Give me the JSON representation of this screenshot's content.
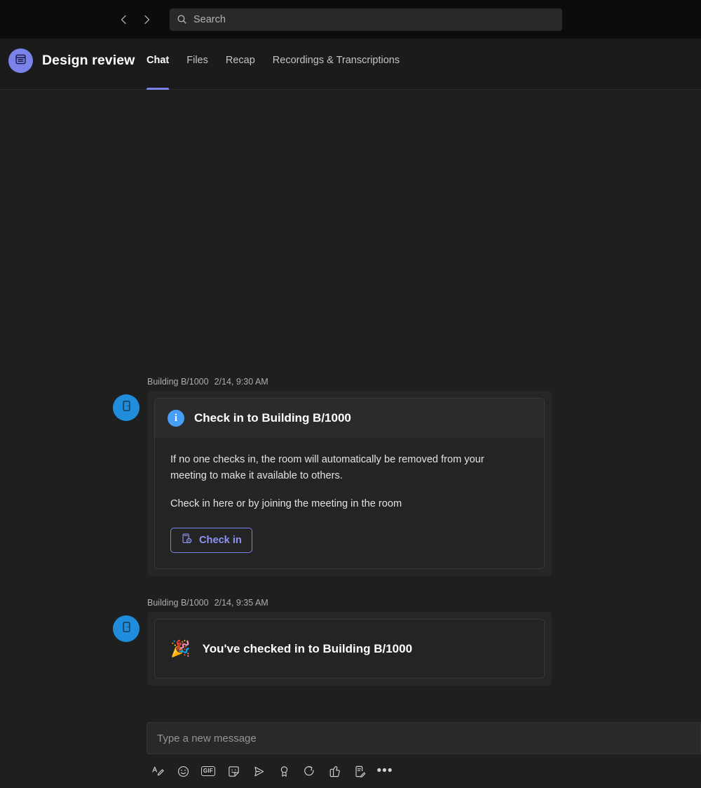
{
  "titlebar": {
    "back_icon": "chevron-left-icon",
    "forward_icon": "chevron-right-icon",
    "search": {
      "icon": "search-icon",
      "value": "",
      "placeholder": "Search"
    }
  },
  "header": {
    "avatar_icon": "meeting-calendar-icon",
    "title": "Design review",
    "tabs": [
      {
        "label": "Chat",
        "active": true
      },
      {
        "label": "Files",
        "active": false
      },
      {
        "label": "Recap",
        "active": false
      },
      {
        "label": "Recordings & Transcriptions",
        "active": false
      }
    ]
  },
  "messages": [
    {
      "sender": "Building B/1000",
      "timestamp": "2/14, 9:30 AM",
      "avatar_icon": "room-door-icon",
      "card": {
        "header_icon": "info-icon",
        "header_title": "Check in to Building B/1000",
        "paragraphs": [
          "If no one checks in, the room will automatically be removed from your meeting to make it available to others.",
          "Check in here or by joining the meeting in the room"
        ],
        "button": {
          "label": "Check in",
          "icon": "room-checkin-icon"
        }
      }
    },
    {
      "sender": "Building B/1000",
      "timestamp": "2/14, 9:35 AM",
      "avatar_icon": "room-door-icon",
      "confirmation": {
        "emoji": "🎉",
        "text": "You've checked in to Building B/1000"
      }
    }
  ],
  "compose": {
    "value": "",
    "placeholder": "Type a new message",
    "tools": [
      {
        "name": "format-text-icon",
        "label": "Format"
      },
      {
        "name": "emoji-icon",
        "label": "Emoji"
      },
      {
        "name": "gif-icon",
        "label": "GIF"
      },
      {
        "name": "sticker-icon",
        "label": "Sticker"
      },
      {
        "name": "send-plane-icon",
        "label": "Send"
      },
      {
        "name": "praise-ribbon-icon",
        "label": "Praise"
      },
      {
        "name": "loop-icon",
        "label": "Loop component"
      },
      {
        "name": "approvals-icon",
        "label": "Approvals"
      },
      {
        "name": "notes-icon",
        "label": "Notes"
      },
      {
        "name": "more-options-icon",
        "label": "More options"
      }
    ]
  },
  "colors": {
    "accent": "#7b83eb",
    "room_avatar": "#1f8ddc",
    "info_blue": "#479ef5",
    "app_bg": "#1f1f1f",
    "titlebar_bg": "#0c0c0c"
  }
}
